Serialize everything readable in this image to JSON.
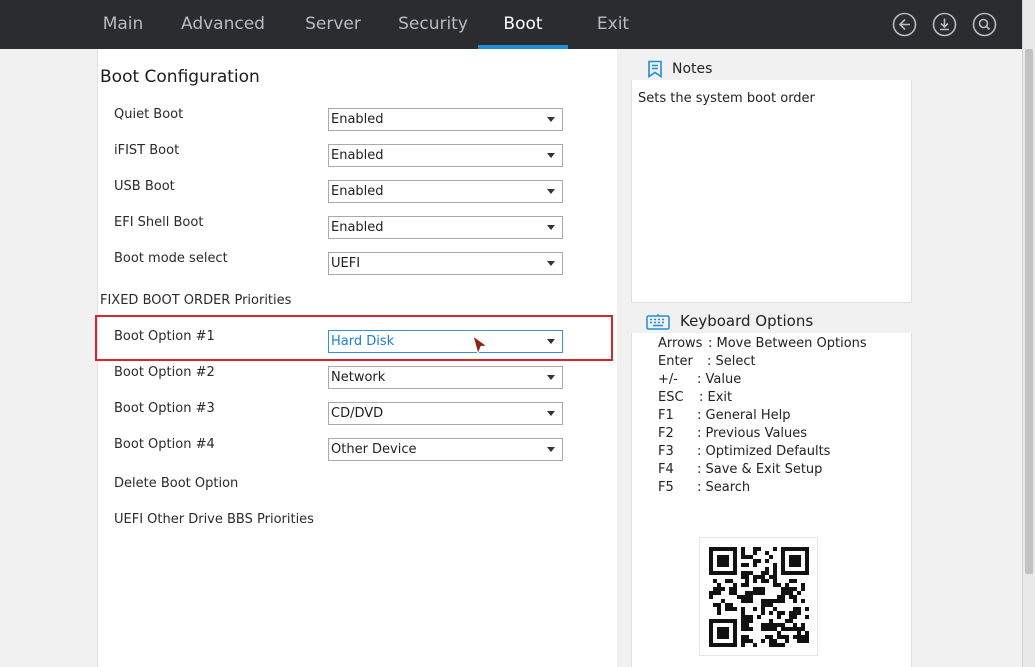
{
  "nav": {
    "tabs": [
      {
        "label": "Main"
      },
      {
        "label": "Advanced"
      },
      {
        "label": "Server"
      },
      {
        "label": "Security"
      },
      {
        "label": "Boot",
        "active": true
      },
      {
        "label": "Exit"
      }
    ],
    "icons": [
      "back-icon",
      "save-download-icon",
      "search-icon"
    ]
  },
  "boot_config": {
    "title": "Boot Configuration",
    "settings": [
      {
        "label": "Quiet Boot",
        "value": "Enabled"
      },
      {
        "label": "iFIST Boot",
        "value": "Enabled"
      },
      {
        "label": "USB Boot",
        "value": "Enabled"
      },
      {
        "label": "EFI Shell Boot",
        "value": "Enabled"
      },
      {
        "label": "Boot mode select",
        "value": "UEFI"
      }
    ],
    "priorities_title": "FIXED BOOT ORDER Priorities",
    "boot_options": [
      {
        "label": "Boot Option #1",
        "value": "Hard Disk",
        "selected": true
      },
      {
        "label": "Boot Option #2",
        "value": "Network"
      },
      {
        "label": "Boot Option #3",
        "value": "CD/DVD"
      },
      {
        "label": "Boot Option #4",
        "value": "Other Device"
      }
    ],
    "links": [
      {
        "label": "Delete Boot Option"
      },
      {
        "label": "UEFI Other Drive BBS Priorities"
      }
    ]
  },
  "notes": {
    "title": "Notes",
    "icon": "bookmark-icon",
    "text": "Sets the system boot order"
  },
  "keyboard": {
    "title": "Keyboard Options",
    "icon": "keyboard-icon",
    "items": [
      {
        "key": "Arrows",
        "desc": ": Move Between Options"
      },
      {
        "key": "Enter",
        "desc": ": Select"
      },
      {
        "key": "+/-",
        "desc": ": Value"
      },
      {
        "key": "ESC",
        "desc": ": Exit"
      },
      {
        "key": "F1",
        "desc": ": General Help"
      },
      {
        "key": "F2",
        "desc": ": Previous Values"
      },
      {
        "key": "F3",
        "desc": ": Optimized Defaults"
      },
      {
        "key": "F4",
        "desc": ": Save & Exit Setup"
      },
      {
        "key": "F5",
        "desc": ": Search"
      }
    ]
  },
  "colors": {
    "topbar": "#2b2c30",
    "accent": "#1e8fd6",
    "highlight": "#d8242c"
  }
}
